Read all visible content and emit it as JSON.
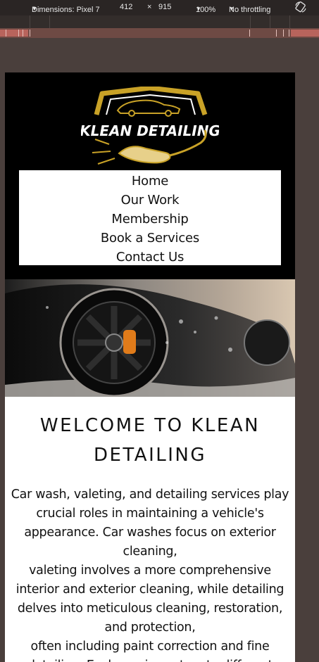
{
  "devtools": {
    "dimensions_label": "Dimensions: Pixel 7",
    "width": "412",
    "times": "×",
    "height": "915",
    "zoom": "100%",
    "throttling": "No throttling",
    "rotate_icon": "rotate-icon"
  },
  "site": {
    "logo_text": "KLEAN DETAILING",
    "logo_colors": {
      "gold": "#c9a227",
      "white": "#ffffff"
    },
    "nav": [
      {
        "label": "Home"
      },
      {
        "label": "Our Work"
      },
      {
        "label": "Membership"
      },
      {
        "label": "Book a Services"
      },
      {
        "label": "Contact Us"
      }
    ],
    "welcome": {
      "title": "WELCOME TO KLEAN DETAILING",
      "body_lines": [
        "Car wash, valeting, and detailing services play crucial roles in maintaining a vehicle's appearance. Car washes focus on exterior cleaning,",
        "valeting involves a more comprehensive interior and exterior cleaning, while detailing delves into meticulous cleaning, restoration, and protection,",
        "often including paint correction and fine detailing. Each service caters to different"
      ]
    }
  }
}
